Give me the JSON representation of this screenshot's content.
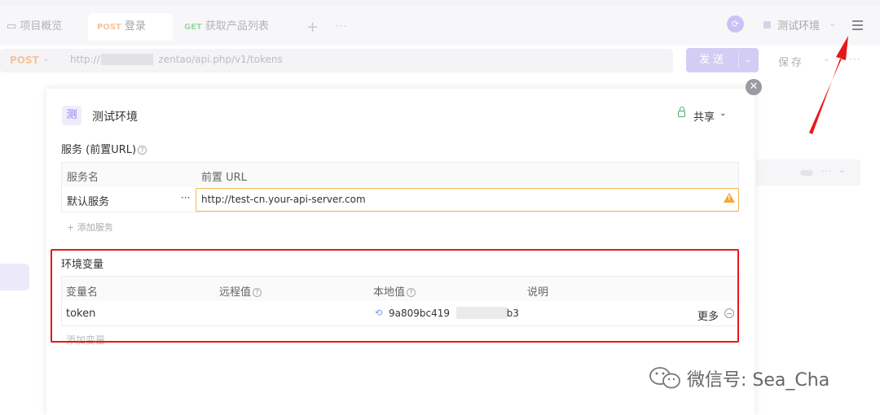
{
  "tabs": [
    {
      "method": "",
      "label": "项目概览"
    },
    {
      "method": "POST",
      "label": "登录"
    },
    {
      "method": "GET",
      "label": "获取产品列表"
    }
  ],
  "tabbar": {
    "add": "+",
    "more": "···",
    "environment": "测试环境"
  },
  "request": {
    "method": "POST",
    "url_prefix": "http://1",
    "url_suffix": "zentao/api.php/v1/tokens",
    "send_label": "发送",
    "save_label": "保存"
  },
  "modal": {
    "env_badge": "测",
    "env_name": "测试环境",
    "share_label": "共享",
    "services": {
      "heading": "服务 (前置URL)",
      "col_name": "服务名",
      "col_url": "前置 URL",
      "rows": [
        {
          "name": "默认服务",
          "url": "http://test-cn.your-api-server.com"
        }
      ],
      "add_label": "+ 添加服务"
    },
    "variables": {
      "heading": "环境变量",
      "col_name": "变量名",
      "col_remote": "远程值",
      "col_local": "本地值",
      "col_desc": "说明",
      "rows": [
        {
          "name": "token",
          "remote": "",
          "local_prefix": "9a809bc419",
          "local_suffix": "6b3",
          "desc": "",
          "more": "更多"
        }
      ],
      "add_label": "添加变量"
    }
  },
  "watermark": "微信号: Sea_Cha",
  "colors": {
    "highlight": "#e8171a",
    "warning": "#f0b64d",
    "accent": "#8a7cf0"
  }
}
